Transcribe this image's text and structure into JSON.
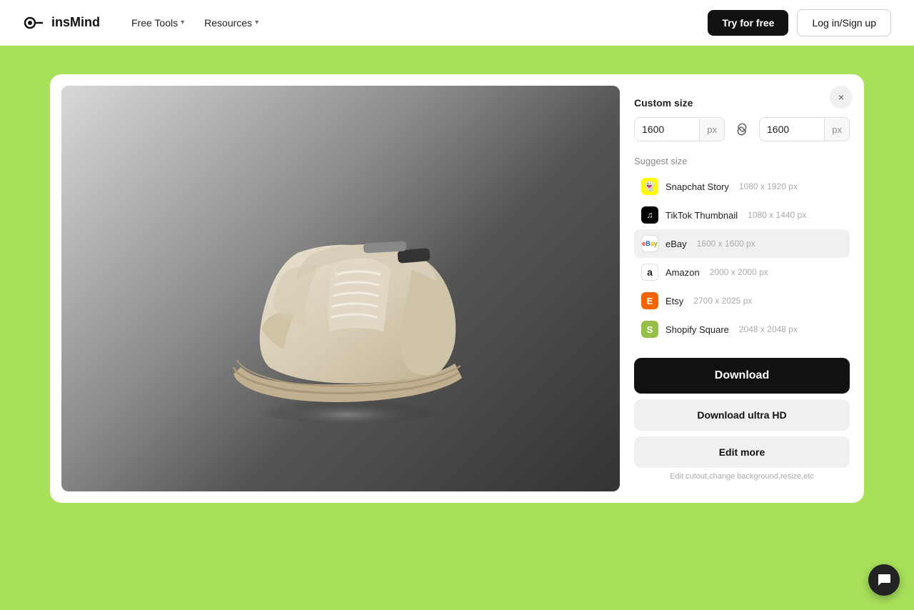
{
  "navbar": {
    "logo_text": "insMind",
    "free_tools_label": "Free Tools",
    "resources_label": "Resources",
    "try_label": "Try for free",
    "login_label": "Log in/Sign up"
  },
  "panel": {
    "close_label": "×",
    "custom_size_title": "Custom size",
    "width_value": "1600",
    "height_value": "1600",
    "px_unit": "px",
    "suggest_size_title": "Suggest size",
    "suggest_items": [
      {
        "id": "snapchat",
        "name": "Snapchat Story",
        "dims": "1080 x 1920 px",
        "icon_bg": "#FFFC00",
        "icon_color": "#fff",
        "icon_char": "👻"
      },
      {
        "id": "tiktok",
        "name": "TikTok Thumbnail",
        "dims": "1080 x 1440 px",
        "icon_bg": "#000",
        "icon_color": "#fff",
        "icon_char": "♪"
      },
      {
        "id": "ebay",
        "name": "eBay",
        "dims": "1600 x 1600 px",
        "icon_bg": "#fff",
        "icon_color": "#e53238",
        "icon_char": "eBay"
      },
      {
        "id": "amazon",
        "name": "Amazon",
        "dims": "2000 x 2000 px",
        "icon_bg": "#fff",
        "icon_color": "#FF9900",
        "icon_char": "a"
      },
      {
        "id": "etsy",
        "name": "Etsy",
        "dims": "2700 x 2025 px",
        "icon_bg": "#F56400",
        "icon_color": "#fff",
        "icon_char": "E"
      },
      {
        "id": "shopify",
        "name": "Shopify Square",
        "dims": "2048 x 2048 px",
        "icon_bg": "#96BF48",
        "icon_color": "#fff",
        "icon_char": "S"
      }
    ],
    "download_label": "Download",
    "download_hd_label": "Download ultra HD",
    "edit_more_label": "Edit more",
    "edit_hint": "Edit cutout,change background,resize,etc"
  }
}
